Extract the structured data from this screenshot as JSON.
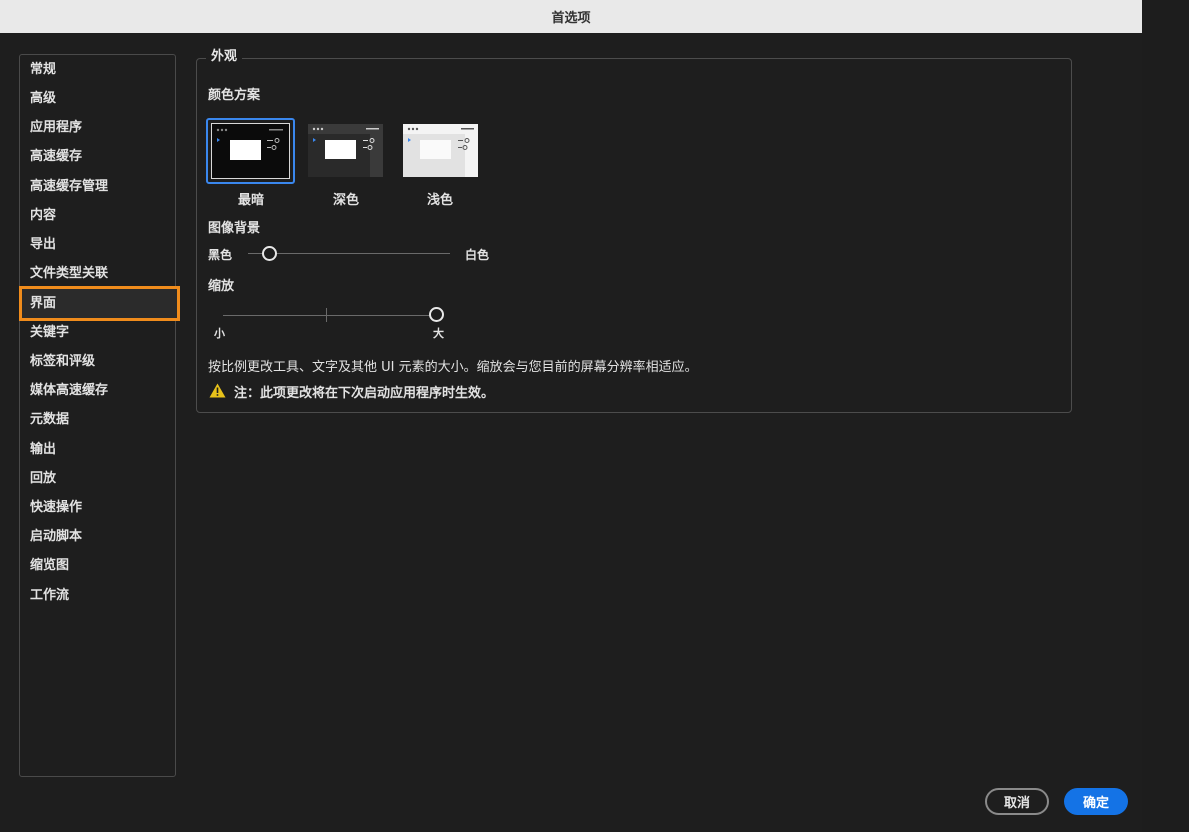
{
  "window": {
    "title": "首选项"
  },
  "sidebar": {
    "items": [
      {
        "label": "常规"
      },
      {
        "label": "高级"
      },
      {
        "label": "应用程序"
      },
      {
        "label": "高速缓存"
      },
      {
        "label": "高速缓存管理"
      },
      {
        "label": "内容"
      },
      {
        "label": "导出"
      },
      {
        "label": "文件类型关联"
      },
      {
        "label": "界面",
        "selected": true
      },
      {
        "label": "关键字"
      },
      {
        "label": "标签和评级"
      },
      {
        "label": "媒体高速缓存"
      },
      {
        "label": "元数据"
      },
      {
        "label": "输出"
      },
      {
        "label": "回放"
      },
      {
        "label": "快速操作"
      },
      {
        "label": "启动脚本"
      },
      {
        "label": "缩览图"
      },
      {
        "label": "工作流"
      }
    ]
  },
  "appearance": {
    "group_title": "外观",
    "color_scheme_label": "颜色方案",
    "schemes": [
      {
        "label": "最暗",
        "selected": true
      },
      {
        "label": "深色"
      },
      {
        "label": "浅色"
      }
    ],
    "image_background_label": "图像背景",
    "bg_min_label": "黑色",
    "bg_max_label": "白色",
    "bg_value": 0.1,
    "zoom_label": "缩放",
    "zoom_min_label": "小",
    "zoom_max_label": "大",
    "zoom_value": 1.0,
    "description": "按比例更改工具、文字及其他 UI 元素的大小。缩放会与您目前的屏幕分辨率相适应。",
    "note": "注：此项更改将在下次启动应用程序时生效。"
  },
  "buttons": {
    "cancel": "取消",
    "ok": "确定"
  },
  "colors": {
    "accent": "#1473e6",
    "selection": "#f08c1c",
    "warning": "#e8c21a"
  }
}
